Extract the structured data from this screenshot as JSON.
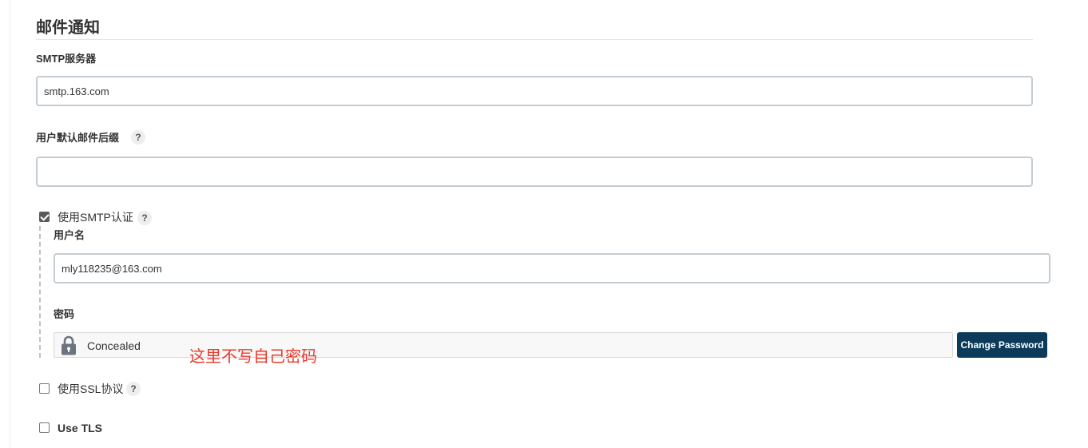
{
  "section": {
    "title": "邮件通知"
  },
  "smtp_server": {
    "label": "SMTP服务器",
    "value": "smtp.163.com"
  },
  "default_suffix": {
    "label": "用户默认邮件后缀",
    "value": "",
    "help": "?"
  },
  "smtp_auth": {
    "label": "使用SMTP认证",
    "checked": true,
    "help": "?",
    "username": {
      "label": "用户名",
      "value": "mly118235@163.com"
    },
    "password": {
      "label": "密码",
      "concealed_text": "Concealed",
      "change_button": "Change Password"
    }
  },
  "annotation": {
    "text": "这里不写自己密码",
    "color": "#e8392b"
  },
  "ssl": {
    "label": "使用SSL协议",
    "checked": false,
    "help": "?"
  },
  "tls": {
    "label": "Use TLS",
    "checked": false
  },
  "colors": {
    "button_bg": "#0b3a5a",
    "input_border": "#c5ccd1"
  },
  "icons": {
    "lock": "lock-icon",
    "help": "question-mark-icon"
  }
}
